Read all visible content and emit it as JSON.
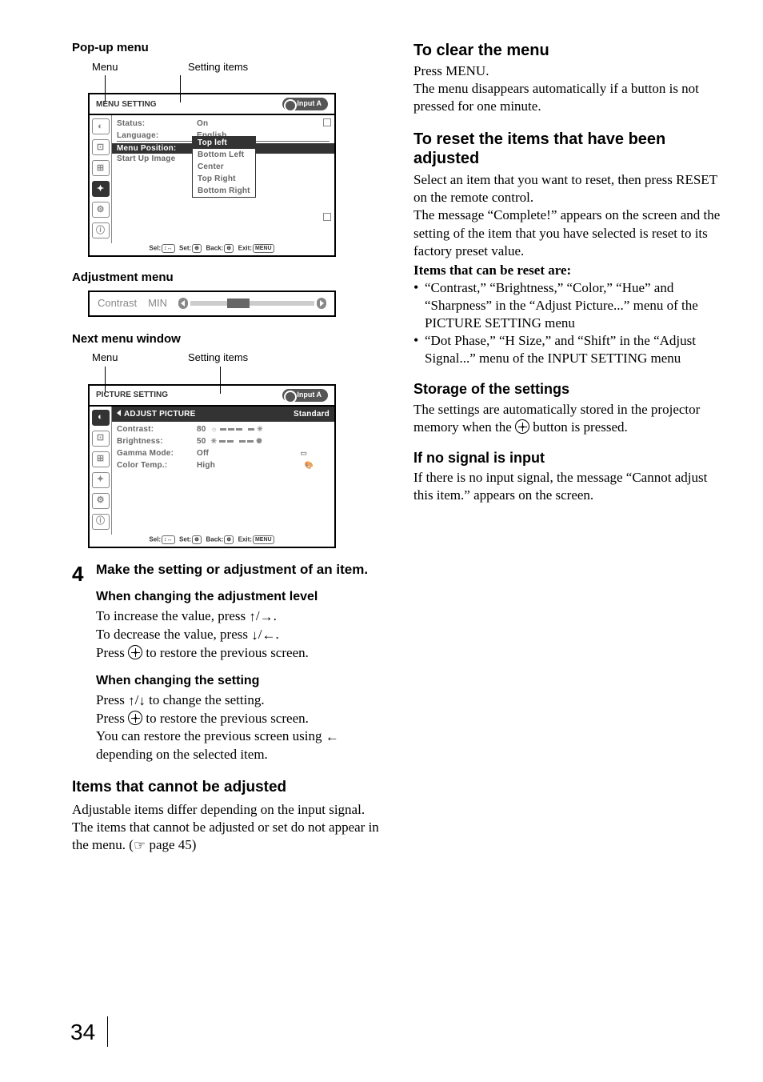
{
  "left": {
    "popup_label": "Pop-up menu",
    "labels": {
      "menu": "Menu",
      "setting_items": "Setting items"
    },
    "menu1": {
      "title": "MENU SETTING",
      "input": "Input A",
      "rows": {
        "status_k": "Status:",
        "status_v": "On",
        "lang_k": "Language:",
        "lang_v": "English",
        "pos_k": "Menu Position:",
        "start_k": "Start Up Image"
      },
      "dropdown": [
        "Top left",
        "Bottom Left",
        "Center",
        "Top Right",
        "Bottom Right"
      ],
      "footer_sel": "Sel:",
      "footer_set": "Set:",
      "footer_back": "Back:",
      "footer_exit": "Exit:",
      "footer_menu": "MENU"
    },
    "adjustment_label": "Adjustment menu",
    "adj": {
      "name": "Contrast",
      "min": "MIN"
    },
    "next_label": "Next menu window",
    "menu2": {
      "title": "PICTURE SETTING",
      "input": "Input A",
      "subhead": "ADJUST PICTURE",
      "standard": "Standard",
      "rows": {
        "contrast_k": "Contrast:",
        "contrast_v": "80",
        "bright_k": "Brightness:",
        "bright_v": "50",
        "gamma_k": "Gamma Mode:",
        "gamma_v": "Off",
        "ct_k": "Color Temp.:",
        "ct_v": "High"
      }
    },
    "step4": {
      "num": "4",
      "head": "Make the setting or adjustment of an item.",
      "sub1": "When changing the adjustment level",
      "p1a": "To increase the value, press ",
      "p1b": "To decrease the value, press ",
      "p1c_a": "Press ",
      "p1c_b": " to restore the previous screen.",
      "sub2": "When changing the setting",
      "p2a_a": "Press ",
      "p2a_b": " to change the setting.",
      "p2b_a": "Press ",
      "p2b_b": " to restore the previous screen.",
      "p2c_a": "You can restore the previous screen using ",
      "p2c_b": " depending on the selected item."
    },
    "cannot": {
      "head": "Items that cannot be adjusted",
      "body_a": "Adjustable items differ depending on the input signal. The items that cannot be adjusted or set do not appear in the menu. (",
      "body_b": " page 45)"
    }
  },
  "right": {
    "clear": {
      "head": "To clear the menu",
      "p1": "Press MENU.",
      "p2": "The menu disappears automatically if a button is not pressed for one minute."
    },
    "reset": {
      "head": "To reset the items that have been adjusted",
      "p1": "Select an item that you want to reset, then press RESET on the remote control.",
      "p2": "The message “Complete!” appears on the screen and the setting of the item that you have selected is reset to its factory preset value.",
      "items_head": "Items that can be reset are:",
      "b1": "“Contrast,” “Brightness,” “Color,” “Hue” and “Sharpness” in the “Adjust Picture...” menu of the PICTURE SETTING menu",
      "b2": "“Dot Phase,” “H Size,” and “Shift” in the “Adjust Signal...” menu of the INPUT SETTING menu"
    },
    "storage": {
      "head": "Storage of the settings",
      "p_a": "The settings are automatically stored in the projector memory when the ",
      "p_b": " button is pressed."
    },
    "nosignal": {
      "head": "If no signal is input",
      "p": "If there is no input signal, the message “Cannot adjust this item.” appears on the screen."
    }
  },
  "page_number": "34"
}
